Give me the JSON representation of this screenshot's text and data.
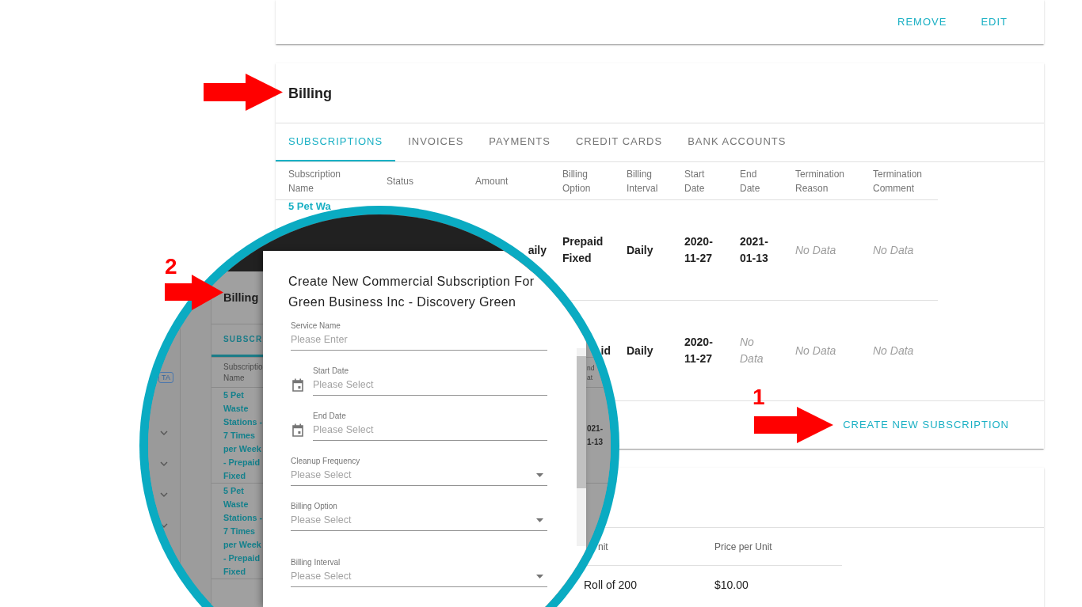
{
  "top_card": {
    "actions": [
      {
        "label": "REMOVE"
      },
      {
        "label": "EDIT"
      }
    ]
  },
  "billing": {
    "title": "Billing",
    "tabs": [
      {
        "label": "SUBSCRIPTIONS",
        "selected": true
      },
      {
        "label": "INVOICES",
        "selected": false
      },
      {
        "label": "PAYMENTS",
        "selected": false
      },
      {
        "label": "CREDIT CARDS",
        "selected": false
      },
      {
        "label": "BANK ACCOUNTS",
        "selected": false
      }
    ],
    "table": {
      "columns": [
        "Subscription Name",
        "Status",
        "Amount",
        "Billing Option",
        "Billing Interval",
        "Start Date",
        "End Date",
        "Termination Reason",
        "Termination Comment"
      ],
      "rows": [
        {
          "cells": [
            {
              "kind": "link",
              "text": "5 Pet Wa"
            },
            null,
            {
              "kind": "clipped",
              "text": "aily"
            },
            {
              "kind": "value",
              "text": "Prepaid Fixed"
            },
            {
              "kind": "value",
              "text": "Daily"
            },
            {
              "kind": "value",
              "text": "2020-11-27"
            },
            {
              "kind": "value",
              "text": "2021-01-13"
            },
            {
              "kind": "empty",
              "text": "No Data"
            },
            {
              "kind": "empty",
              "text": "No Data"
            }
          ]
        },
        {
          "cells": [
            null,
            null,
            null,
            {
              "kind": "clipped",
              "text": "id"
            },
            {
              "kind": "value",
              "text": "Daily"
            },
            {
              "kind": "value",
              "text": "2020-11-27"
            },
            {
              "kind": "empty",
              "text": "No Data"
            },
            {
              "kind": "empty",
              "text": "No Data"
            },
            {
              "kind": "empty",
              "text": "No Data"
            }
          ]
        }
      ]
    },
    "create_button": "CREATE NEW SUBSCRIPTION"
  },
  "products": {
    "table": {
      "columns": [
        {
          "kind": "clipped",
          "label": "nit"
        },
        {
          "kind": "plain",
          "label": "Price per Unit"
        }
      ],
      "rows": [
        {
          "cells": [
            "Roll of 200",
            "$10.00"
          ]
        }
      ]
    }
  },
  "magnifier": {
    "sidebar": {
      "badge": "TA",
      "items": [
        {
          "expanded": false
        },
        {
          "expanded": false
        },
        {
          "expanded": false
        },
        {
          "expanded": false
        }
      ]
    },
    "page": {
      "title": "Billing",
      "tab": {
        "label": "SUBSCR",
        "selected": true
      },
      "columns": [
        "Subscriptio Name",
        "nd at"
      ],
      "rows": [
        {
          "cells": [
            "5 Pet Waste Stations - 7 Times per Week - Prepaid Fixed",
            "021- 1-13"
          ]
        },
        {
          "cells": [
            "5 Pet Waste Stations - 7 Times per Week - Prepaid Fixed"
          ]
        }
      ]
    },
    "dialog": {
      "title": "Create New Commercial Subscription For Green Business Inc - Discovery Green",
      "fields": [
        {
          "kind": "text",
          "label": "Service Name",
          "placeholder": "Please Enter"
        },
        {
          "kind": "date",
          "label": "Start Date",
          "placeholder": "Please Select"
        },
        {
          "kind": "date",
          "label": "End Date",
          "placeholder": "Please Select"
        },
        {
          "kind": "select",
          "label": "Cleanup Frequency",
          "placeholder": "Please Select"
        },
        {
          "kind": "select",
          "label": "Billing Option",
          "placeholder": "Please Select"
        },
        {
          "kind": "select",
          "label": "Billing Interval",
          "placeholder": "Please Select"
        }
      ]
    }
  },
  "annotations": [
    {
      "kind": "arrow"
    },
    {
      "kind": "numbered_arrow",
      "number": "2"
    },
    {
      "kind": "numbered_arrow",
      "number": "1"
    }
  ]
}
